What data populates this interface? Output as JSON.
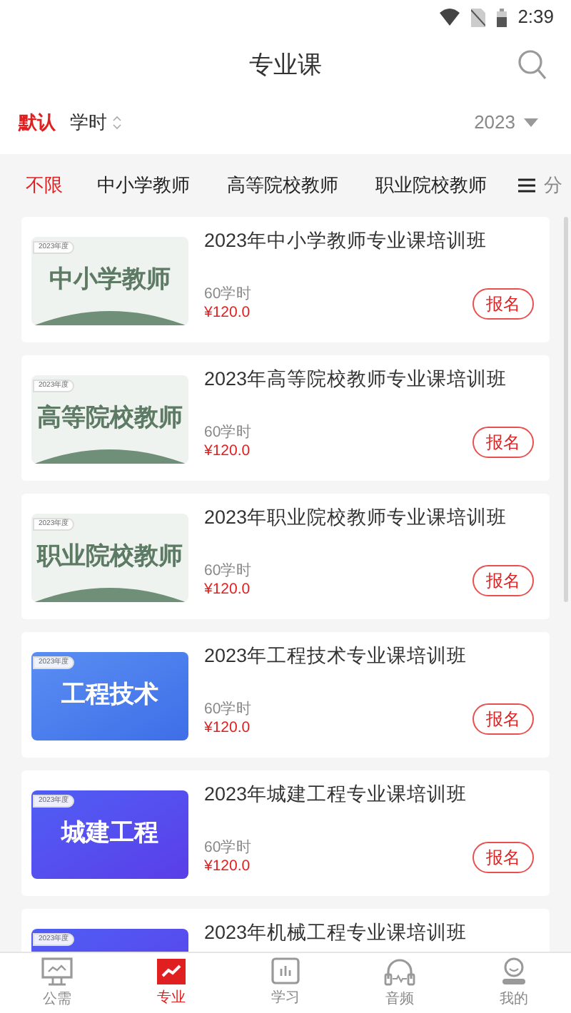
{
  "status_bar": {
    "time": "2:39"
  },
  "header": {
    "title": "专业课"
  },
  "sort_options": [
    {
      "label": "默认",
      "selected": true,
      "kind": "plain"
    },
    {
      "label": "学时",
      "selected": false,
      "kind": "sortable"
    }
  ],
  "year_filter": {
    "value": "2023"
  },
  "categories": [
    {
      "label": "不限",
      "selected": true
    },
    {
      "label": "中小学教师",
      "selected": false
    },
    {
      "label": "高等院校教师",
      "selected": false
    },
    {
      "label": "职业院校教师",
      "selected": false
    }
  ],
  "category_menu": {
    "label": "分"
  },
  "courses": [
    {
      "kind": "green",
      "thumb_badge": "2023年度",
      "thumb_title": "中小学教师",
      "title": "2023年中小学教师专业课培训班",
      "hours": "60学时",
      "price": "¥120.0",
      "action": "报名"
    },
    {
      "kind": "green",
      "thumb_badge": "2023年度",
      "thumb_title": "高等院校教师",
      "title": "2023年高等院校教师专业课培训班",
      "hours": "60学时",
      "price": "¥120.0",
      "action": "报名"
    },
    {
      "kind": "green",
      "thumb_badge": "2023年度",
      "thumb_title": "职业院校教师",
      "title": "2023年职业院校教师专业课培训班",
      "hours": "60学时",
      "price": "¥120.0",
      "action": "报名"
    },
    {
      "kind": "blue",
      "thumb_badge": "2023年度",
      "thumb_title": "工程技术",
      "title": "2023年工程技术专业课培训班",
      "hours": "60学时",
      "price": "¥120.0",
      "action": "报名"
    },
    {
      "kind": "purple",
      "thumb_badge": "2023年度",
      "thumb_title": "城建工程",
      "title": "2023年城建工程专业课培训班",
      "hours": "60学时",
      "price": "¥120.0",
      "action": "报名"
    },
    {
      "kind": "purple",
      "thumb_badge": "2023年度",
      "title": "2023年机械工程专业课培训班"
    }
  ],
  "tab_bar": [
    {
      "label": "公需",
      "selected": false
    },
    {
      "label": "专业",
      "selected": true
    },
    {
      "label": "学习",
      "selected": false
    },
    {
      "label": "音频",
      "selected": false
    },
    {
      "label": "我的",
      "selected": false
    }
  ]
}
